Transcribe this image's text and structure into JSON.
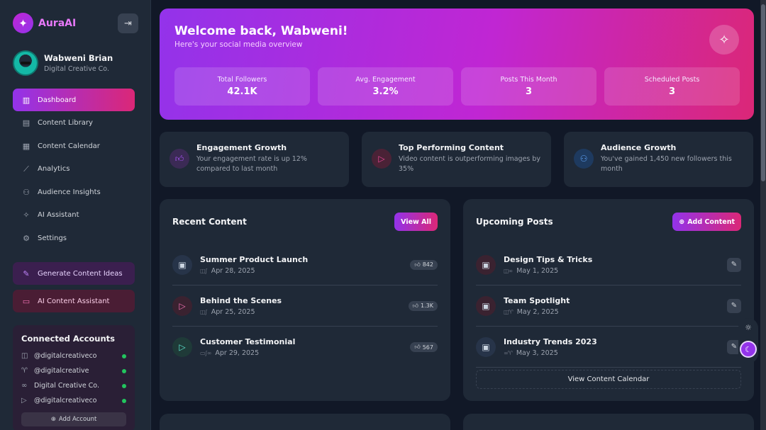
{
  "brand": {
    "name": "AuraAI"
  },
  "profile": {
    "name": "Wabweni Brian",
    "org": "Digital Creative Co."
  },
  "nav": [
    {
      "label": "Dashboard",
      "icon": "bar-chart-icon"
    },
    {
      "label": "Content Library",
      "icon": "document-icon"
    },
    {
      "label": "Content Calendar",
      "icon": "calendar-icon"
    },
    {
      "label": "Analytics",
      "icon": "line-chart-icon"
    },
    {
      "label": "Audience Insights",
      "icon": "users-icon"
    },
    {
      "label": "AI Assistant",
      "icon": "sparkles-icon"
    },
    {
      "label": "Settings",
      "icon": "gear-icon"
    }
  ],
  "actions": {
    "generate": "Generate Content Ideas",
    "assistant": "AI Content Assistant"
  },
  "accounts": {
    "title": "Connected Accounts",
    "items": [
      {
        "label": "@digitalcreativeco",
        "icon": "instagram-icon"
      },
      {
        "label": "@digitalcreative",
        "icon": "twitter-icon"
      },
      {
        "label": "Digital Creative Co.",
        "icon": "link-icon"
      },
      {
        "label": "@digitalcreativeco",
        "icon": "video-icon"
      }
    ],
    "add_label": "Add Account"
  },
  "hero": {
    "title": "Welcome back, Wabweni!",
    "subtitle": "Here's your social media overview",
    "stats": [
      {
        "label": "Total Followers",
        "value": "42.1K"
      },
      {
        "label": "Avg. Engagement",
        "value": "3.2%"
      },
      {
        "label": "Posts This Month",
        "value": "3"
      },
      {
        "label": "Scheduled Posts",
        "value": "3"
      }
    ]
  },
  "insights": [
    {
      "title": "Engagement Growth",
      "desc": "Your engagement rate is up 12% compared to last month",
      "icon": "thumbs-up-icon",
      "color": "#a855f7",
      "bg": "#3b2a55"
    },
    {
      "title": "Top Performing Content",
      "desc": "Video content is outperforming images by 35%",
      "icon": "video-icon",
      "color": "#ec4899",
      "bg": "#4a2236"
    },
    {
      "title": "Audience Growth",
      "desc": "You've gained 1,450 new followers this month",
      "icon": "users-icon",
      "color": "#60a5fa",
      "bg": "#1e3a5f"
    }
  ],
  "recent": {
    "title": "Recent Content",
    "button": "View All",
    "items": [
      {
        "title": "Summer Product Launch",
        "date": "Apr 28, 2025",
        "likes": "842",
        "icon": "layout-icon",
        "bg": "#273449"
      },
      {
        "title": "Behind the Scenes",
        "date": "Apr 25, 2025",
        "likes": "1.3K",
        "icon": "video-icon",
        "bg": "#3a2230"
      },
      {
        "title": "Customer Testimonial",
        "date": "Apr 29, 2025",
        "likes": "567",
        "icon": "video-icon",
        "bg": "#1f3a38"
      }
    ]
  },
  "upcoming": {
    "title": "Upcoming Posts",
    "button": "Add Content",
    "items": [
      {
        "title": "Design Tips & Tricks",
        "date": "May 1, 2025",
        "icon": "layout-icon",
        "bg": "#3a2230"
      },
      {
        "title": "Team Spotlight",
        "date": "May 2, 2025",
        "icon": "layout-icon",
        "bg": "#3a2230"
      },
      {
        "title": "Industry Trends 2023",
        "date": "May 3, 2025",
        "icon": "layout-icon",
        "bg": "#273449"
      }
    ],
    "calendar_link": "View Content Calendar"
  }
}
